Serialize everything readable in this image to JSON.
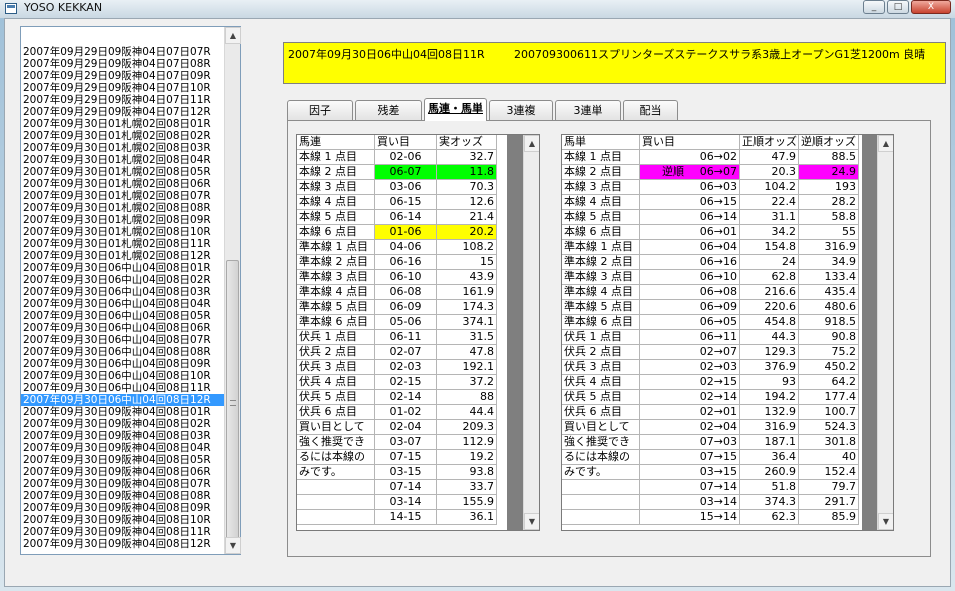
{
  "window": {
    "title": "YOSO KEKKAN",
    "btn_min": "_",
    "btn_max": "□",
    "btn_close": "X"
  },
  "race_list": {
    "selected_index": 29,
    "items": [
      "2007年09月29日09阪神04日07日07R",
      "2007年09月29日09阪神04日07日08R",
      "2007年09月29日09阪神04日07日09R",
      "2007年09月29日09阪神04日07日10R",
      "2007年09月29日09阪神04日07日11R",
      "2007年09月29日09阪神04日07日12R",
      "2007年09月30日01札幌02回08日01R",
      "2007年09月30日01札幌02回08日02R",
      "2007年09月30日01札幌02回08日03R",
      "2007年09月30日01札幌02回08日04R",
      "2007年09月30日01札幌02回08日05R",
      "2007年09月30日01札幌02回08日06R",
      "2007年09月30日01札幌02回08日07R",
      "2007年09月30日01札幌02回08日08R",
      "2007年09月30日01札幌02回08日09R",
      "2007年09月30日01札幌02回08日10R",
      "2007年09月30日01札幌02回08日11R",
      "2007年09月30日01札幌02回08日12R",
      "2007年09月30日06中山04回08日01R",
      "2007年09月30日06中山04回08日02R",
      "2007年09月30日06中山04回08日03R",
      "2007年09月30日06中山04回08日04R",
      "2007年09月30日06中山04回08日05R",
      "2007年09月30日06中山04回08日06R",
      "2007年09月30日06中山04回08日07R",
      "2007年09月30日06中山04回08日08R",
      "2007年09月30日06中山04回08日09R",
      "2007年09月30日06中山04回08日10R",
      "2007年09月30日06中山04回08日11R",
      "2007年09月30日06中山04回08日12R",
      "2007年09月30日09阪神04回08日01R",
      "2007年09月30日09阪神04回08日02R",
      "2007年09月30日09阪神04回08日03R",
      "2007年09月30日09阪神04回08日04R",
      "2007年09月30日09阪神04回08日05R",
      "2007年09月30日09阪神04回08日06R",
      "2007年09月30日09阪神04回08日07R",
      "2007年09月30日09阪神04回08日08R",
      "2007年09月30日09阪神04回08日09R",
      "2007年09月30日09阪神04回08日10R",
      "2007年09月30日09阪神04回08日11R",
      "2007年09月30日09阪神04回08日12R"
    ]
  },
  "race_header": {
    "left": "2007年09月30日06中山04回08日11R",
    "right": "200709300611スプリンターズステークスサラ系3歳上オープンG1芝1200m 良晴"
  },
  "tabs": [
    "因子",
    "残差",
    "馬連・馬単",
    "3連複",
    "3連単",
    "配当"
  ],
  "active_tab": 2,
  "colors": {
    "highlight_green": "#00ff00",
    "highlight_yellow": "#ffff00",
    "highlight_magenta": "#ff00ff",
    "header_yellow": "#ffff00",
    "selection_blue": "#3399ff"
  },
  "umaren": {
    "headers": [
      "馬連",
      "買い目",
      "実オッズ"
    ],
    "rows": [
      {
        "label": "本線 1 点目",
        "pair": "02-06",
        "odds": "32.7",
        "hl": ""
      },
      {
        "label": "本線 2 点目",
        "pair": "06-07",
        "odds": "11.8",
        "hl": "green"
      },
      {
        "label": "本線 3 点目",
        "pair": "03-06",
        "odds": "70.3",
        "hl": ""
      },
      {
        "label": "本線 4 点目",
        "pair": "06-15",
        "odds": "12.6",
        "hl": ""
      },
      {
        "label": "本線 5 点目",
        "pair": "06-14",
        "odds": "21.4",
        "hl": ""
      },
      {
        "label": "本線 6 点目",
        "pair": "01-06",
        "odds": "20.2",
        "hl": "yellow"
      },
      {
        "label": "準本線 1 点目",
        "pair": "04-06",
        "odds": "108.2",
        "hl": ""
      },
      {
        "label": "準本線 2 点目",
        "pair": "06-16",
        "odds": "15",
        "hl": ""
      },
      {
        "label": "準本線 3 点目",
        "pair": "06-10",
        "odds": "43.9",
        "hl": ""
      },
      {
        "label": "準本線 4 点目",
        "pair": "06-08",
        "odds": "161.9",
        "hl": ""
      },
      {
        "label": "準本線 5 点目",
        "pair": "06-09",
        "odds": "174.3",
        "hl": ""
      },
      {
        "label": "準本線 6 点目",
        "pair": "05-06",
        "odds": "374.1",
        "hl": ""
      },
      {
        "label": "伏兵 1 点目",
        "pair": "06-11",
        "odds": "31.5",
        "hl": ""
      },
      {
        "label": "伏兵 2 点目",
        "pair": "02-07",
        "odds": "47.8",
        "hl": ""
      },
      {
        "label": "伏兵 3 点目",
        "pair": "02-03",
        "odds": "192.1",
        "hl": ""
      },
      {
        "label": "伏兵 4 点目",
        "pair": "02-15",
        "odds": "37.2",
        "hl": ""
      },
      {
        "label": "伏兵 5 点目",
        "pair": "02-14",
        "odds": "88",
        "hl": ""
      },
      {
        "label": "伏兵 6 点目",
        "pair": "01-02",
        "odds": "44.4",
        "hl": ""
      },
      {
        "label": "買い目として",
        "pair": "02-04",
        "odds": "209.3",
        "hl": ""
      },
      {
        "label": "強く推奨でき",
        "pair": "03-07",
        "odds": "112.9",
        "hl": ""
      },
      {
        "label": "るには本線の",
        "pair": "07-15",
        "odds": "19.2",
        "hl": ""
      },
      {
        "label": "みです。",
        "pair": "03-15",
        "odds": "93.8",
        "hl": ""
      },
      {
        "label": "",
        "pair": "07-14",
        "odds": "33.7",
        "hl": ""
      },
      {
        "label": "",
        "pair": "03-14",
        "odds": "155.9",
        "hl": ""
      },
      {
        "label": "",
        "pair": "14-15",
        "odds": "36.1",
        "hl": ""
      }
    ]
  },
  "umatan": {
    "headers": [
      "馬単",
      "買い目",
      "正順オッズ",
      "逆順オッズ"
    ],
    "rows": [
      {
        "label": "本線 1 点目",
        "tag": "",
        "pair": "06→02",
        "fwd": "47.9",
        "rev": "88.5",
        "hl": ""
      },
      {
        "label": "本線 2 点目",
        "tag": "逆順",
        "pair": "06→07",
        "fwd": "20.3",
        "rev": "24.9",
        "hl": "magenta"
      },
      {
        "label": "本線 3 点目",
        "tag": "",
        "pair": "06→03",
        "fwd": "104.2",
        "rev": "193",
        "hl": ""
      },
      {
        "label": "本線 4 点目",
        "tag": "",
        "pair": "06→15",
        "fwd": "22.4",
        "rev": "28.2",
        "hl": ""
      },
      {
        "label": "本線 5 点目",
        "tag": "",
        "pair": "06→14",
        "fwd": "31.1",
        "rev": "58.8",
        "hl": ""
      },
      {
        "label": "本線 6 点目",
        "tag": "",
        "pair": "06→01",
        "fwd": "34.2",
        "rev": "55",
        "hl": ""
      },
      {
        "label": "準本線 1 点目",
        "tag": "",
        "pair": "06→04",
        "fwd": "154.8",
        "rev": "316.9",
        "hl": ""
      },
      {
        "label": "準本線 2 点目",
        "tag": "",
        "pair": "06→16",
        "fwd": "24",
        "rev": "34.9",
        "hl": ""
      },
      {
        "label": "準本線 3 点目",
        "tag": "",
        "pair": "06→10",
        "fwd": "62.8",
        "rev": "133.4",
        "hl": ""
      },
      {
        "label": "準本線 4 点目",
        "tag": "",
        "pair": "06→08",
        "fwd": "216.6",
        "rev": "435.4",
        "hl": ""
      },
      {
        "label": "準本線 5 点目",
        "tag": "",
        "pair": "06→09",
        "fwd": "220.6",
        "rev": "480.6",
        "hl": ""
      },
      {
        "label": "準本線 6 点目",
        "tag": "",
        "pair": "06→05",
        "fwd": "454.8",
        "rev": "918.5",
        "hl": ""
      },
      {
        "label": "伏兵 1 点目",
        "tag": "",
        "pair": "06→11",
        "fwd": "44.3",
        "rev": "90.8",
        "hl": ""
      },
      {
        "label": "伏兵 2 点目",
        "tag": "",
        "pair": "02→07",
        "fwd": "129.3",
        "rev": "75.2",
        "hl": ""
      },
      {
        "label": "伏兵 3 点目",
        "tag": "",
        "pair": "02→03",
        "fwd": "376.9",
        "rev": "450.2",
        "hl": ""
      },
      {
        "label": "伏兵 4 点目",
        "tag": "",
        "pair": "02→15",
        "fwd": "93",
        "rev": "64.2",
        "hl": ""
      },
      {
        "label": "伏兵 5 点目",
        "tag": "",
        "pair": "02→14",
        "fwd": "194.2",
        "rev": "177.4",
        "hl": ""
      },
      {
        "label": "伏兵 6 点目",
        "tag": "",
        "pair": "02→01",
        "fwd": "132.9",
        "rev": "100.7",
        "hl": ""
      },
      {
        "label": "買い目として",
        "tag": "",
        "pair": "02→04",
        "fwd": "316.9",
        "rev": "524.3",
        "hl": ""
      },
      {
        "label": "強く推奨でき",
        "tag": "",
        "pair": "07→03",
        "fwd": "187.1",
        "rev": "301.8",
        "hl": ""
      },
      {
        "label": "るには本線の",
        "tag": "",
        "pair": "07→15",
        "fwd": "36.4",
        "rev": "40",
        "hl": ""
      },
      {
        "label": "みです。",
        "tag": "",
        "pair": "03→15",
        "fwd": "260.9",
        "rev": "152.4",
        "hl": ""
      },
      {
        "label": "",
        "tag": "",
        "pair": "07→14",
        "fwd": "51.8",
        "rev": "79.7",
        "hl": ""
      },
      {
        "label": "",
        "tag": "",
        "pair": "03→14",
        "fwd": "374.3",
        "rev": "291.7",
        "hl": ""
      },
      {
        "label": "",
        "tag": "",
        "pair": "15→14",
        "fwd": "62.3",
        "rev": "85.9",
        "hl": ""
      }
    ]
  }
}
